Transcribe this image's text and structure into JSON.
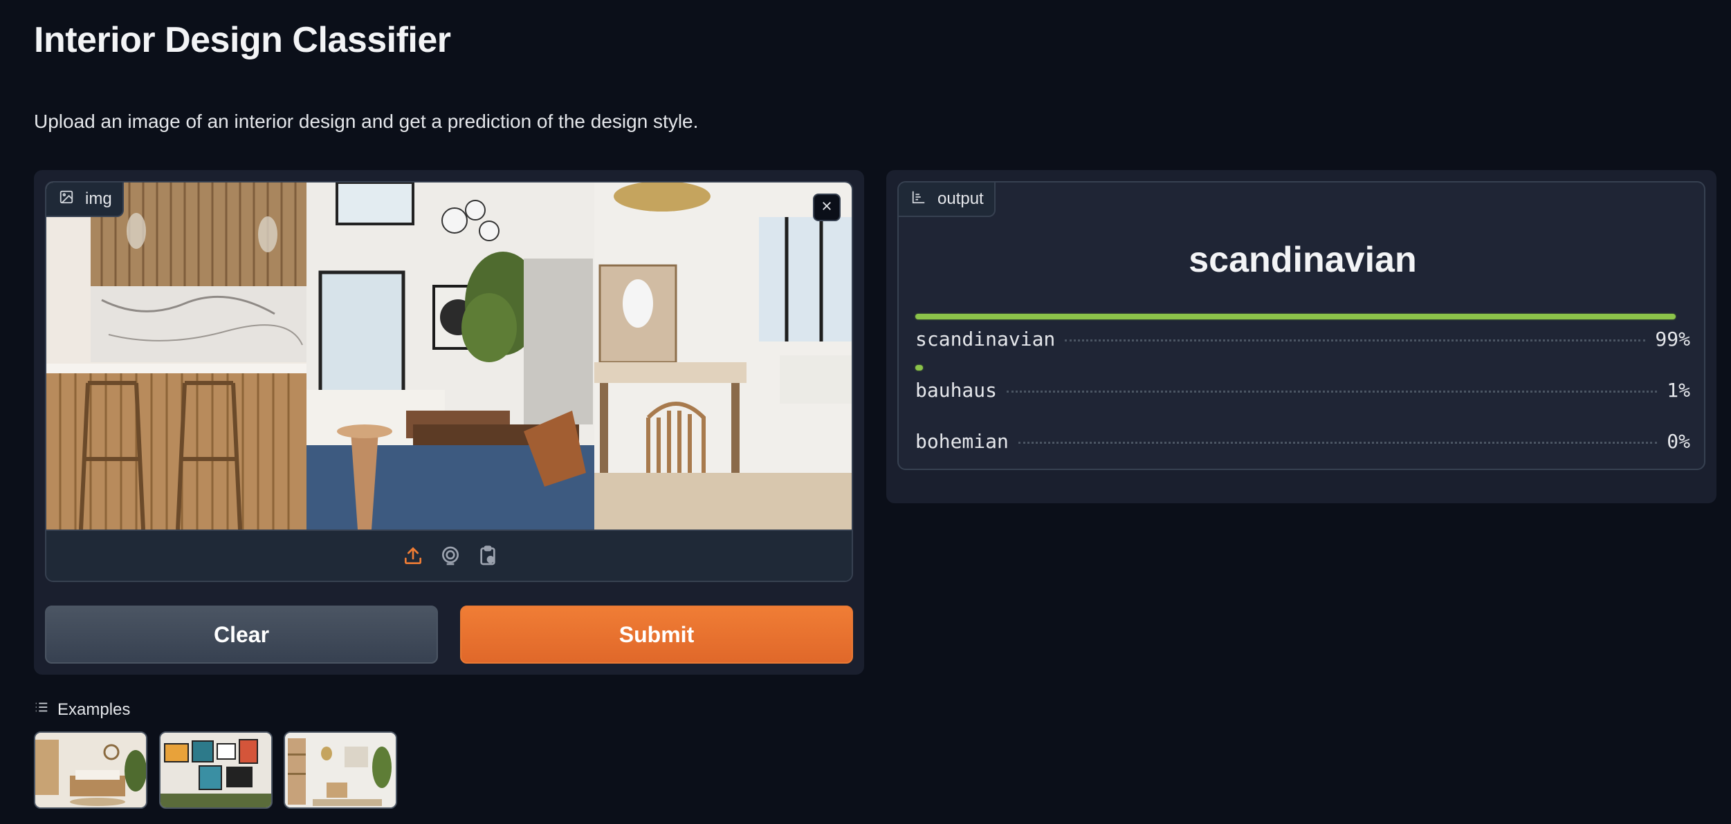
{
  "app": {
    "title": "Interior Design Classifier",
    "description": "Upload an image of an interior design and get a prediction of the design style."
  },
  "input": {
    "label": "img",
    "icons": [
      "image-icon",
      "close-icon",
      "upload-icon",
      "webcam-icon",
      "clipboard-icon"
    ]
  },
  "actions": {
    "clear_label": "Clear",
    "submit_label": "Submit"
  },
  "output": {
    "label": "output",
    "top_label": "scandinavian",
    "confidences": [
      {
        "label": "scandinavian",
        "value": 0.99,
        "display": "99%"
      },
      {
        "label": "bauhaus",
        "value": 0.01,
        "display": "1%"
      },
      {
        "label": "bohemian",
        "value": 0.0,
        "display": "0%"
      }
    ]
  },
  "examples": {
    "label": "Examples",
    "count": 3
  },
  "colors": {
    "background": "#0b0f19",
    "panel": "#1a1f2e",
    "accent_orange": "#e8722f",
    "bar_green": "#8bc34a",
    "clear_gray": "#4b5563"
  }
}
